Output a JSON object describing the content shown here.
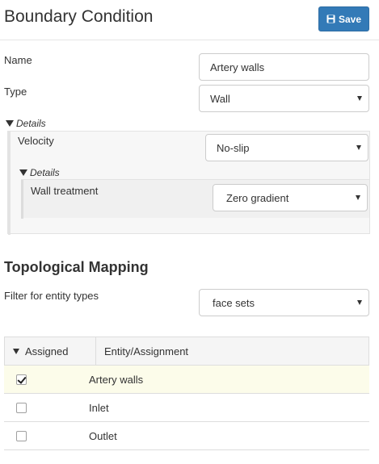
{
  "header": {
    "title": "Boundary Condition",
    "save_label": "Save"
  },
  "form": {
    "name_label": "Name",
    "name_value": "Artery walls",
    "type_label": "Type",
    "type_value": "Wall",
    "details_label": "Details",
    "velocity_label": "Velocity",
    "velocity_value": "No-slip",
    "inner_details_label": "Details",
    "wall_treatment_label": "Wall treatment",
    "wall_treatment_value": "Zero gradient"
  },
  "mapping": {
    "title": "Topological Mapping",
    "filter_label": "Filter for entity types",
    "filter_value": "face sets",
    "columns": [
      "Assigned",
      "Entity/Assignment"
    ],
    "rows": [
      {
        "name": "Artery walls",
        "checked": true
      },
      {
        "name": "Inlet",
        "checked": false
      },
      {
        "name": "Outlet",
        "checked": false
      }
    ]
  },
  "icons": {
    "save": "floppy-disk-icon",
    "expand": "triangle-down-icon",
    "dropdown": "caret-down-icon"
  },
  "colors": {
    "primary": "#337ab7",
    "selected_row": "#fcfcea"
  }
}
